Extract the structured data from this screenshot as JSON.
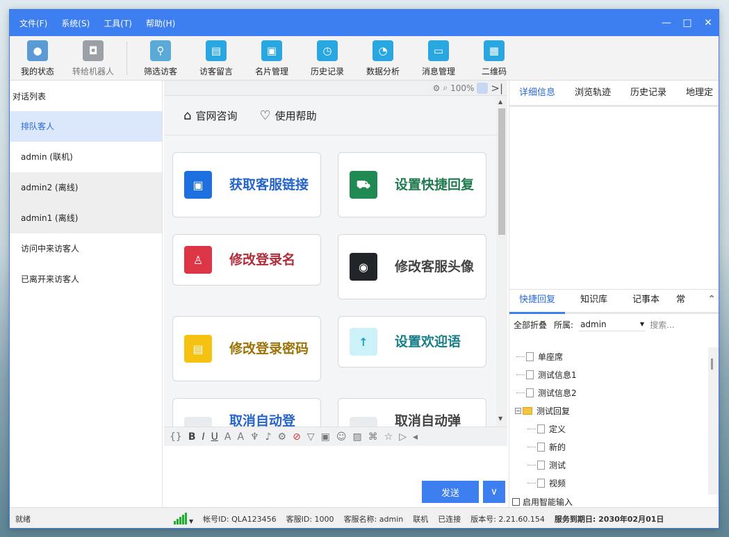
{
  "menu": [
    "文件(F)",
    "系统(S)",
    "工具(T)",
    "帮助(H)"
  ],
  "window_controls": [
    "—",
    "□",
    "✕"
  ],
  "toolbar": [
    {
      "label": "我的状态",
      "color": "#5b9bd5",
      "icon": "user-status-icon"
    },
    {
      "label": "转给机器人",
      "color": "#9aa0a6",
      "icon": "robot-icon"
    },
    {
      "label": "筛选访客",
      "color": "#5aa9d6",
      "icon": "filter-visitor-icon"
    },
    {
      "label": "访客留言",
      "color": "#2aa6e0",
      "icon": "message-icon"
    },
    {
      "label": "名片管理",
      "color": "#2aa6e0",
      "icon": "card-icon"
    },
    {
      "label": "历史记录",
      "color": "#2aa6e0",
      "icon": "clock-icon"
    },
    {
      "label": "数据分析",
      "color": "#2aa6e0",
      "icon": "chart-icon"
    },
    {
      "label": "消息管理",
      "color": "#2aa6e0",
      "icon": "monitor-icon"
    },
    {
      "label": "二维码",
      "color": "#2aa6e0",
      "icon": "qrcode-icon"
    }
  ],
  "left": {
    "title": "对话列表",
    "items": [
      {
        "label": "排队客人",
        "state": "active"
      },
      {
        "label": "admin (联机)",
        "state": "normal"
      },
      {
        "label": "admin2 (离线)",
        "state": "offline"
      },
      {
        "label": "admin1 (离线)",
        "state": "offline"
      },
      {
        "label": "访问中来访客人",
        "state": "normal"
      },
      {
        "label": "已离开来访客人",
        "state": "normal"
      }
    ]
  },
  "center": {
    "zoom": "100%",
    "help_links": [
      "官网咨询",
      "使用帮助"
    ],
    "cards": [
      {
        "label": "获取客服链接",
        "text_color": "#2565c9",
        "icon_color": "#1e6fe0",
        "icon": "web-link-icon"
      },
      {
        "label": "设置快捷回复",
        "text_color": "#1f7a4d",
        "icon_color": "#1f8a52",
        "icon": "cart-icon"
      },
      {
        "label": "修改登录名",
        "text_color": "#b02a37",
        "icon_color": "#dc3545",
        "icon": "user-icon"
      },
      {
        "label": "修改客服头像",
        "text_color": "#444444",
        "icon_color": "#212529",
        "icon": "avatar-icon"
      },
      {
        "label": "修改登录密码",
        "text_color": "#9a7205",
        "icon_color": "#f5c211",
        "icon": "chat-icon"
      },
      {
        "label": "设置欢迎语",
        "text_color": "#177e8a",
        "icon_color": "#cdf1f8",
        "icon": "arrow-up-icon"
      },
      {
        "label": "取消自动登",
        "text_color": "#2565c9",
        "icon_color": "#e9ecef",
        "icon": "user-icon"
      },
      {
        "label": "取消自动弹",
        "text_color": "#444444",
        "icon_color": "#e9ecef",
        "icon": "popup-icon"
      }
    ],
    "send_label": "发送"
  },
  "right": {
    "tabs": [
      "详细信息",
      "浏览轨迹",
      "历史记录",
      "地理定"
    ],
    "bottom_tabs": [
      "快捷回复",
      "知识库",
      "记事本",
      "常"
    ],
    "collapse_all": "全部折叠",
    "belongs_label": "所属:",
    "belongs_value": "admin",
    "search_placeholder": "搜索...",
    "tree": [
      {
        "label": "单座席",
        "level": 0,
        "type": "doc"
      },
      {
        "label": "测试信息1",
        "level": 0,
        "type": "doc"
      },
      {
        "label": "测试信息2",
        "level": 0,
        "type": "doc"
      },
      {
        "label": "测试回复",
        "level": 0,
        "type": "folder"
      },
      {
        "label": "定义",
        "level": 1,
        "type": "doc"
      },
      {
        "label": "新的",
        "level": 1,
        "type": "doc"
      },
      {
        "label": "测试",
        "level": 1,
        "type": "doc"
      },
      {
        "label": "视频",
        "level": 1,
        "type": "doc"
      }
    ],
    "smart_input": "启用智能输入"
  },
  "status": {
    "ready": "就绪",
    "account_id": "帐号ID: QLA123456",
    "agent_id": "客服ID: 1000",
    "agent_name": "客服名称: admin",
    "online": "联机",
    "connected": "已连接",
    "version": "版本号: 2.21.60.154",
    "expiry": "服务到期日: 2030年02月01日"
  }
}
